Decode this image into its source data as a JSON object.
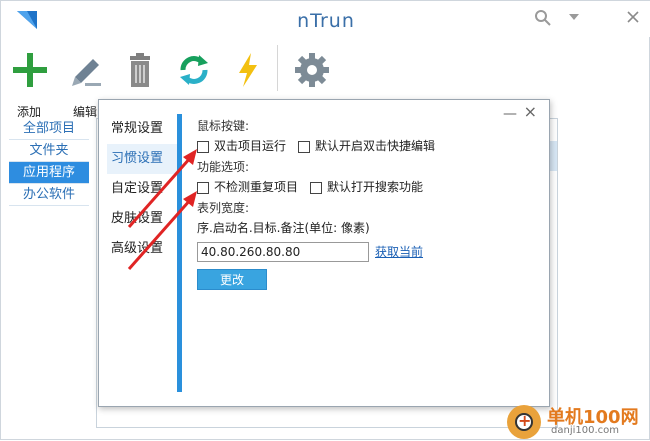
{
  "app": {
    "title": "nTrun"
  },
  "toolbar": [
    {
      "label": "添加",
      "icon": "plus-icon",
      "color": "#2f9e3f"
    },
    {
      "label": "编辑",
      "icon": "pencil-icon",
      "color": "#6f8294"
    },
    {
      "label": "",
      "icon": "trash-icon",
      "color": "#7f7f7f"
    },
    {
      "label": "",
      "icon": "refresh-icon",
      "color": "#17a05d"
    },
    {
      "label": "",
      "icon": "lightning-icon",
      "color": "#f3c010"
    },
    {
      "label": "",
      "icon": "gear-icon",
      "color": "#7d8b96"
    }
  ],
  "sidebar": {
    "items": [
      {
        "label": "全部项目",
        "active": false
      },
      {
        "label": "文件夹",
        "active": false
      },
      {
        "label": "应用程序",
        "active": true
      },
      {
        "label": "办公软件",
        "active": false
      }
    ]
  },
  "dialog": {
    "tabs": [
      {
        "label": "常规设置",
        "active": false
      },
      {
        "label": "习惯设置",
        "active": true
      },
      {
        "label": "自定设置",
        "active": false
      },
      {
        "label": "皮肤设置",
        "active": false
      },
      {
        "label": "高级设置",
        "active": false
      }
    ],
    "mouse_section": "鼠标按键:",
    "mouse_opt1": "双击项目运行",
    "mouse_opt2": "默认开启双击快捷编辑",
    "func_section": "功能选项:",
    "func_opt1": "不检测重复项目",
    "func_opt2": "默认打开搜索功能",
    "width_section": "表列宽度:",
    "width_hint": "序.启动名.目标.备注(单位: 像素)",
    "width_value": "40.80.260.80.80",
    "fetch_link": "获取当前",
    "apply_button": "更改"
  },
  "watermark": {
    "name": "单机100网",
    "url": "danji100.com"
  },
  "colors": {
    "accent": "#2e8de0",
    "annotation_arrow": "#e02424"
  }
}
